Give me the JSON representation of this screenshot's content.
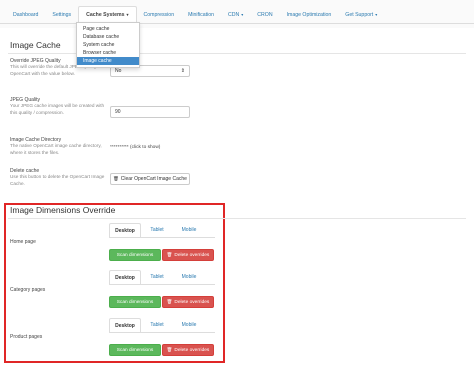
{
  "nav": {
    "tabs": [
      {
        "label": "Dashboard"
      },
      {
        "label": "Settings"
      },
      {
        "label": "Cache Systems",
        "caret": "▾"
      },
      {
        "label": "Compression"
      },
      {
        "label": "Minification"
      },
      {
        "label": "CDN",
        "caret": "▾"
      },
      {
        "label": "CRON"
      },
      {
        "label": "Image Optimization"
      },
      {
        "label": "Get Support",
        "caret": "▾"
      }
    ],
    "dropdown": [
      "Page cache",
      "Database cache",
      "System cache",
      "Browser cache",
      "Image cache"
    ]
  },
  "image_cache": {
    "title": "Image Cache",
    "override_jpeg": {
      "label": "Override JPEG Quality",
      "help": "This will override the default JPEG quality of OpenCart with the value below.",
      "value": "No"
    },
    "jpeg_quality": {
      "label": "JPEG Quality",
      "help": "Your JPEG cache images will be created with this quality / compression.",
      "value": "90"
    },
    "directory": {
      "label": "Image Cache Directory",
      "help": "The native OpenCart image cache directory, where it stores the files.",
      "value": "********** (click to show)"
    },
    "delete_cache": {
      "label": "Delete cache",
      "help": "Use this button to delete the OpenCart Image Cache.",
      "button": "Clear OpenCart Image Cache",
      "button_icon": "trash-icon"
    }
  },
  "dimensions_override": {
    "title": "Image Dimensions Override",
    "highlight_color": "#e02626",
    "groups": [
      {
        "label": "Home page",
        "tabs": [
          "Desktop",
          "Tablet",
          "Mobile"
        ],
        "scan": "Scan dimensions",
        "delete": "Delete overrides"
      },
      {
        "label": "Category pages",
        "tabs": [
          "Desktop",
          "Tablet",
          "Mobile"
        ],
        "scan": "Scan dimensions",
        "delete": "Delete overrides"
      },
      {
        "label": "Product pages",
        "tabs": [
          "Desktop",
          "Tablet",
          "Mobile"
        ],
        "scan": "Scan dimensions",
        "delete": "Delete overrides"
      }
    ]
  }
}
